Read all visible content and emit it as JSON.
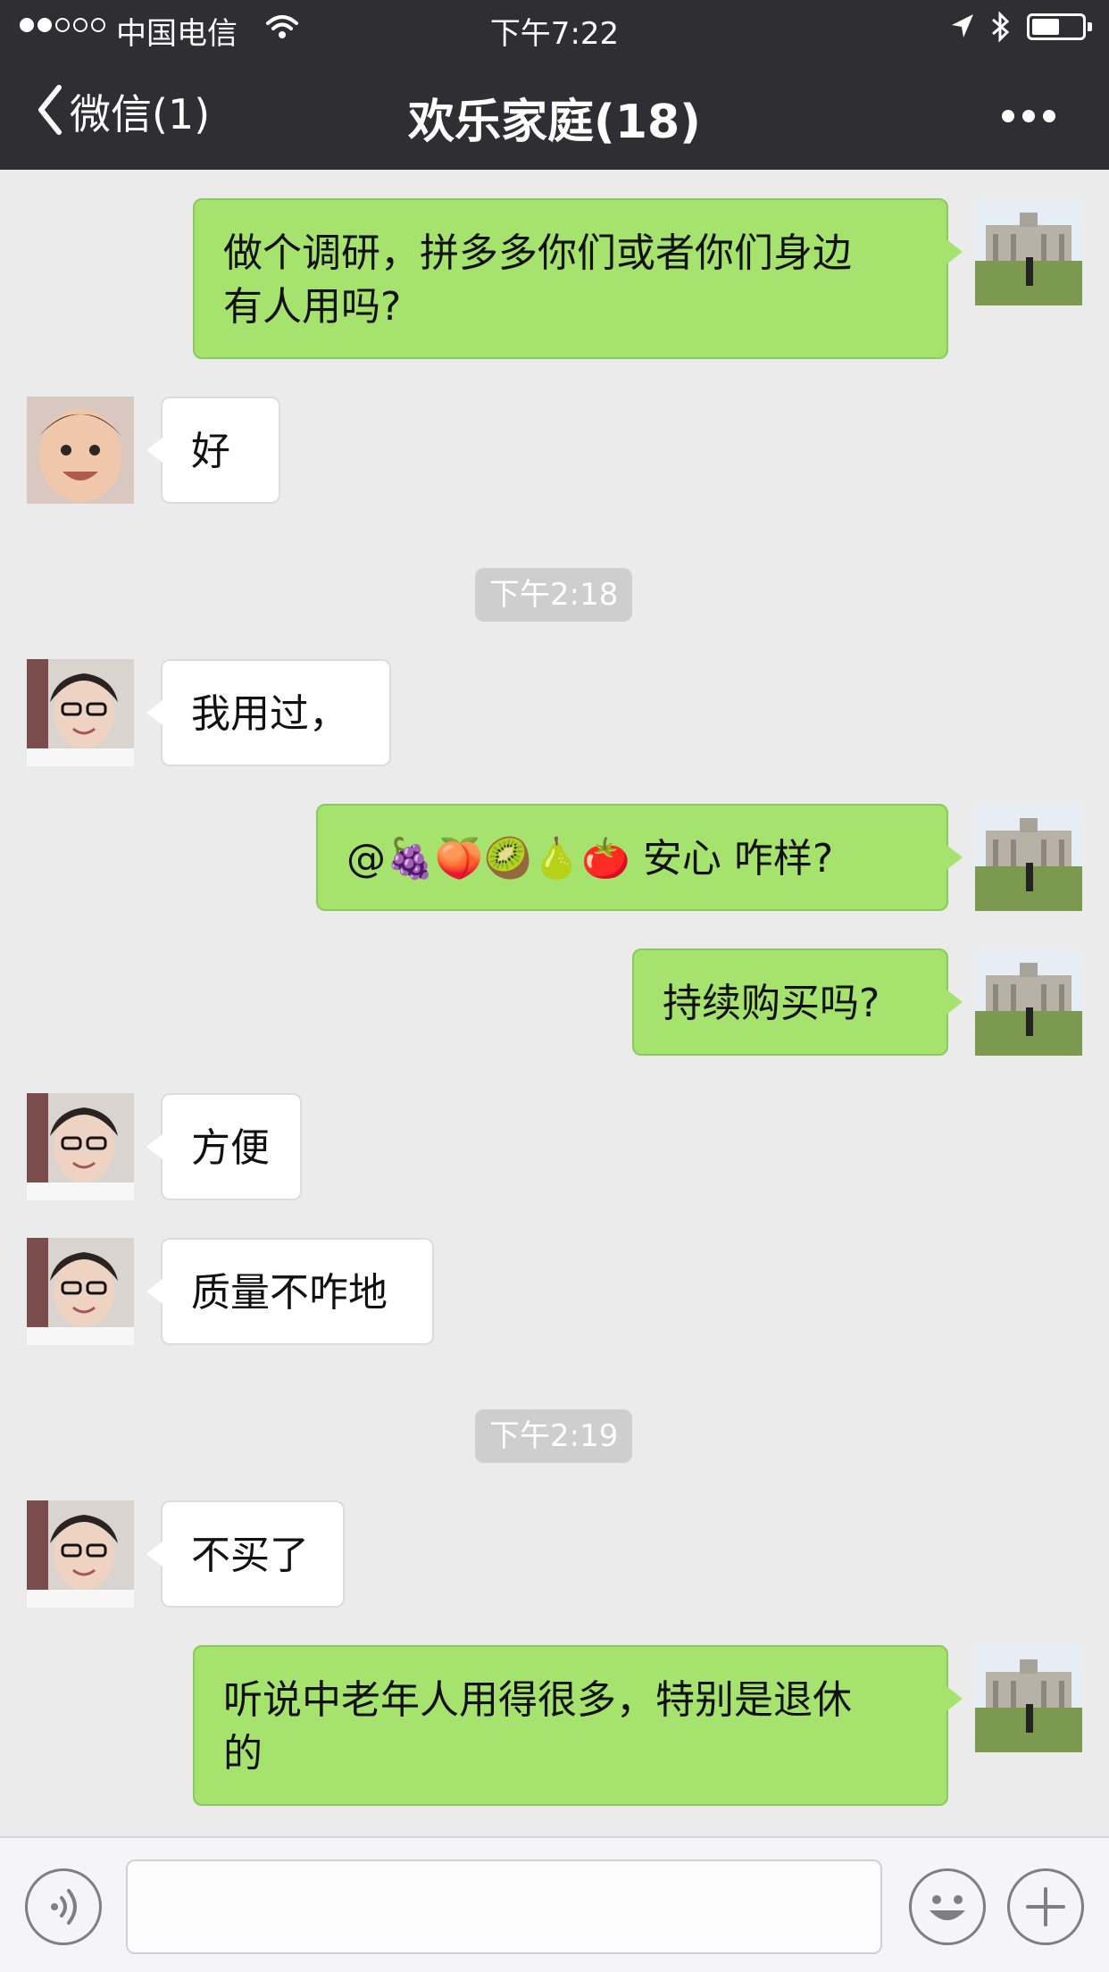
{
  "status_bar": {
    "carrier": "中国电信",
    "time": "下午7:22"
  },
  "nav": {
    "back_label": "微信(1)",
    "title": "欢乐家庭(18)"
  },
  "messages": [
    {
      "type": "self",
      "text_lines": [
        "做个调研，拼多多你们或者你们身边",
        "有人用吗?"
      ]
    },
    {
      "type": "other",
      "avatar": "baby",
      "text": "好"
    },
    {
      "type": "time",
      "text": "下午2:18"
    },
    {
      "type": "other",
      "avatar": "woman",
      "text": "我用过，"
    },
    {
      "type": "self",
      "text": "@🍇🍑🥝🍐🍅 安心 咋样?"
    },
    {
      "type": "self",
      "text": "持续购买吗?"
    },
    {
      "type": "other",
      "avatar": "woman",
      "text": "方便"
    },
    {
      "type": "other",
      "avatar": "woman",
      "text": "质量不咋地"
    },
    {
      "type": "time",
      "text": "下午2:19"
    },
    {
      "type": "other",
      "avatar": "woman",
      "text": "不买了"
    },
    {
      "type": "self",
      "text_lines": [
        "听说中老年人用得很多，特别是退休",
        "的"
      ]
    }
  ],
  "input_bar": {
    "placeholder": "",
    "value": ""
  },
  "icons": {
    "back": "chevron-left-icon",
    "more": "more-horizontal-icon",
    "voice": "voice-icon",
    "emoji": "emoji-icon",
    "plus": "plus-icon",
    "wifi": "wifi-icon",
    "location": "location-arrow-icon",
    "bluetooth": "bluetooth-icon",
    "battery": "battery-icon"
  },
  "colors": {
    "topbar": "#2f2f33",
    "chat_background": "#ebebeb",
    "self_bubble": "#a6e26e",
    "other_bubble": "#ffffff",
    "timestamp_badge": "#cecece"
  }
}
